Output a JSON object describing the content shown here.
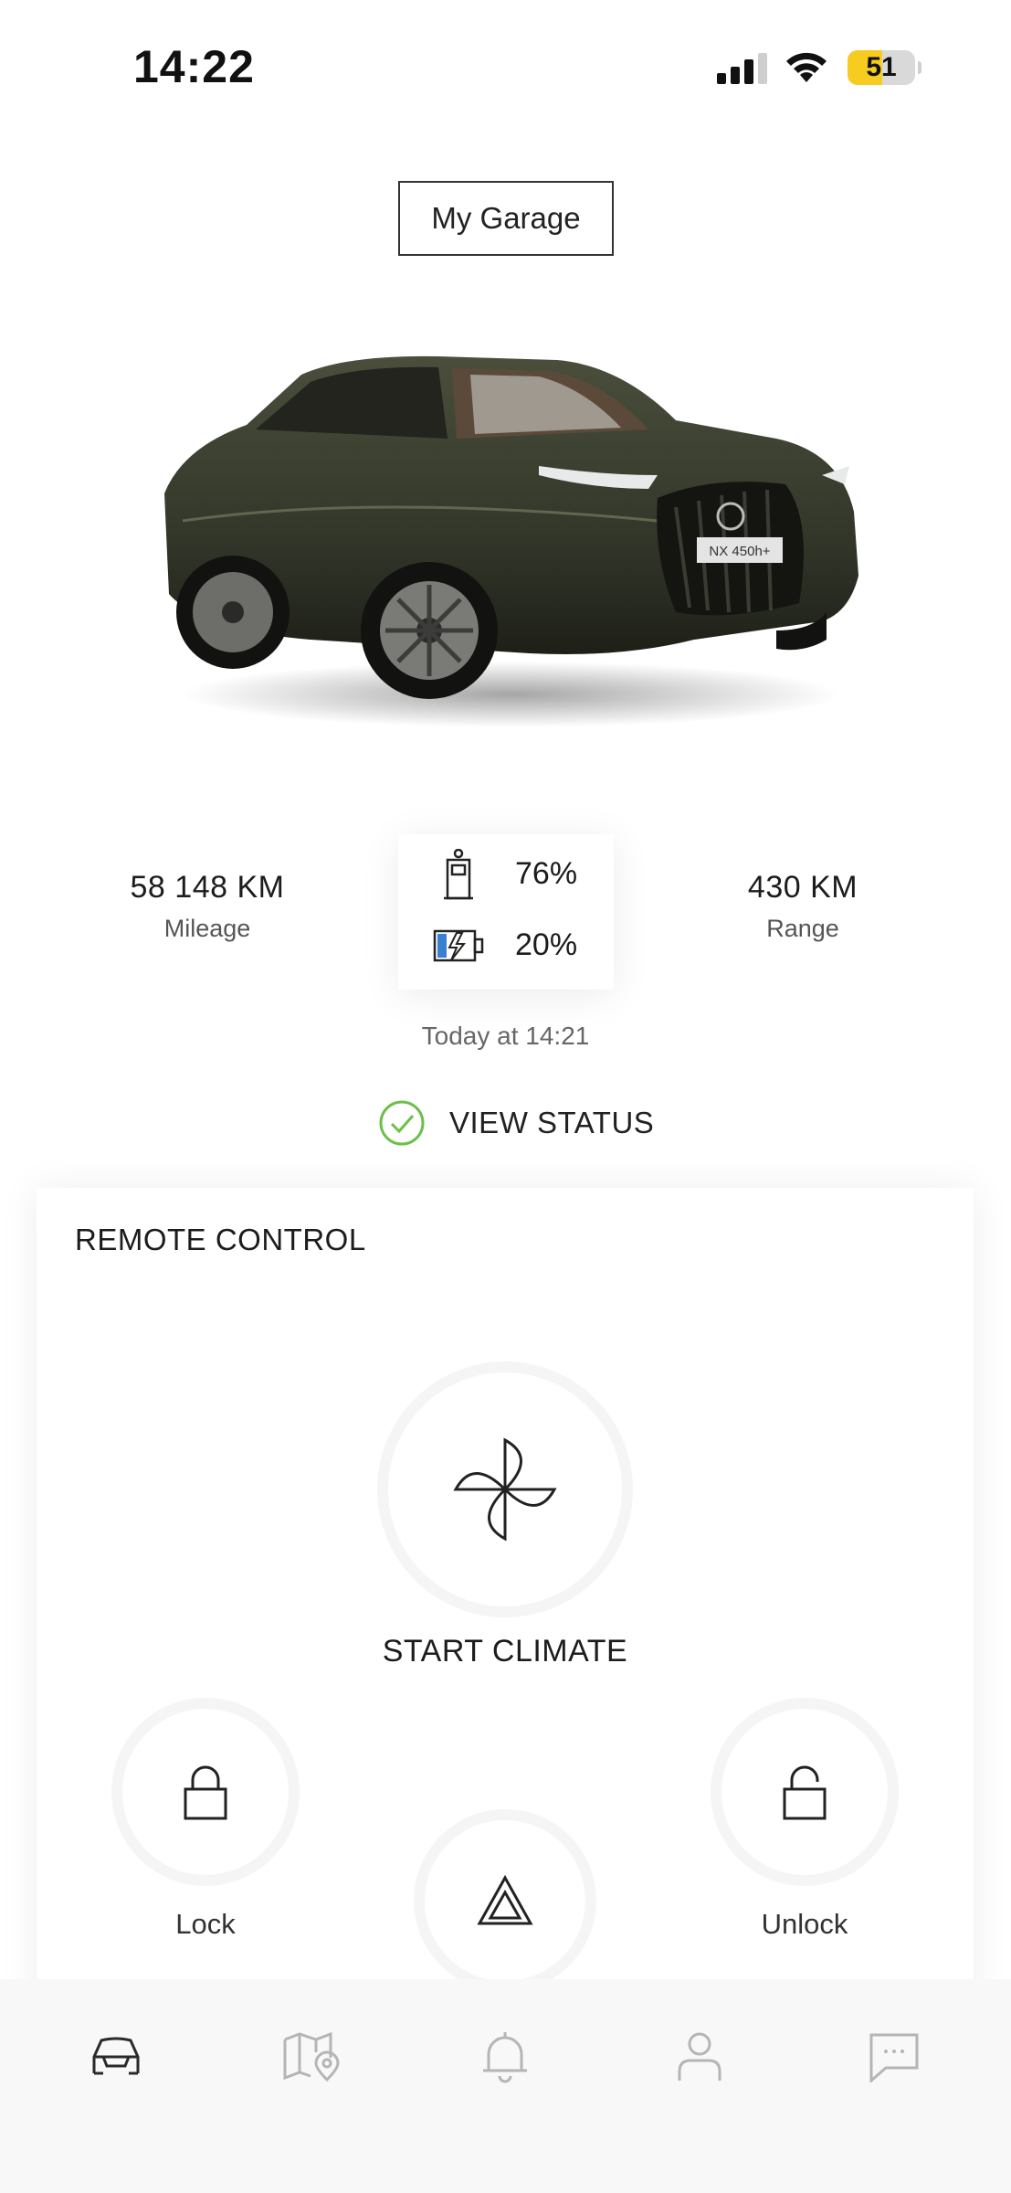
{
  "status_bar": {
    "time": "14:22",
    "battery_level": "51",
    "battery_fraction": 0.51
  },
  "header": {
    "garage_label": "My Garage"
  },
  "vehicle": {
    "plate_text": "NX 450h+",
    "body_color": "#3c3f2e"
  },
  "stats": {
    "mileage_value": "58 148 KM",
    "mileage_label": "Mileage",
    "range_value": "430 KM",
    "range_label": "Range",
    "fuel_percent": "76%",
    "battery_percent": "20%",
    "updated": "Today at 14:21"
  },
  "status": {
    "view_status_label": "VIEW STATUS",
    "check_color": "#6cc04a"
  },
  "remote": {
    "title": "REMOTE CONTROL",
    "climate_label": "START CLIMATE",
    "lock_label": "Lock",
    "unlock_label": "Unlock"
  },
  "nav": {
    "items": [
      "car-icon",
      "map-icon",
      "bell-icon",
      "profile-icon",
      "chat-icon"
    ],
    "active": "car-icon"
  }
}
